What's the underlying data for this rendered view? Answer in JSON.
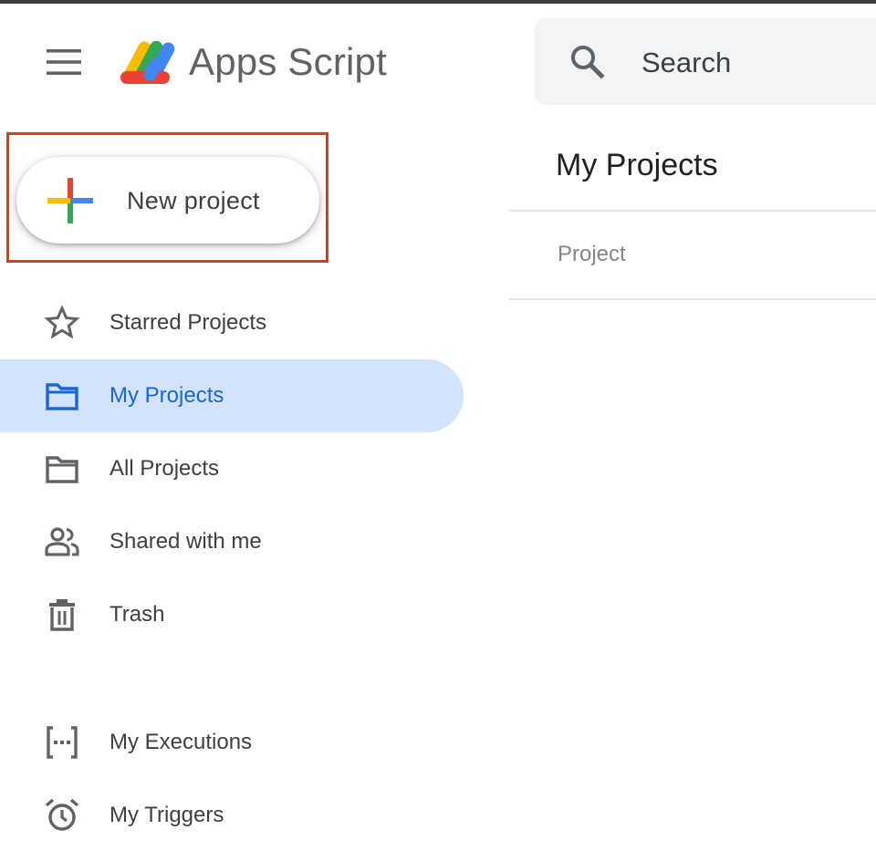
{
  "header": {
    "app_title": "Apps Script",
    "menu_icon": "hamburger-menu-icon",
    "search": {
      "label": "Search",
      "icon": "search-icon"
    }
  },
  "new_project": {
    "label": "New project",
    "icon": "plus-icon"
  },
  "sidebar": {
    "items": [
      {
        "label": "Starred Projects",
        "icon": "star-icon",
        "active": false
      },
      {
        "label": "My Projects",
        "icon": "folder-icon",
        "active": true
      },
      {
        "label": "All Projects",
        "icon": "folder-icon",
        "active": false
      },
      {
        "label": "Shared with me",
        "icon": "people-icon",
        "active": false
      },
      {
        "label": "Trash",
        "icon": "trash-icon",
        "active": false
      },
      {
        "label": "My Executions",
        "icon": "executions-icon",
        "active": false
      },
      {
        "label": "My Triggers",
        "icon": "alarm-icon",
        "active": false
      }
    ]
  },
  "main": {
    "title": "My Projects",
    "table": {
      "columns": [
        "Project"
      ]
    }
  },
  "colors": {
    "active_bg": "#d3e3fd",
    "active_text": "#1967d2",
    "highlight_border": "#ea3323",
    "logo_yellow": "#fbbc04",
    "logo_green": "#34a853",
    "logo_blue": "#4285f4",
    "logo_red": "#ea4335"
  }
}
